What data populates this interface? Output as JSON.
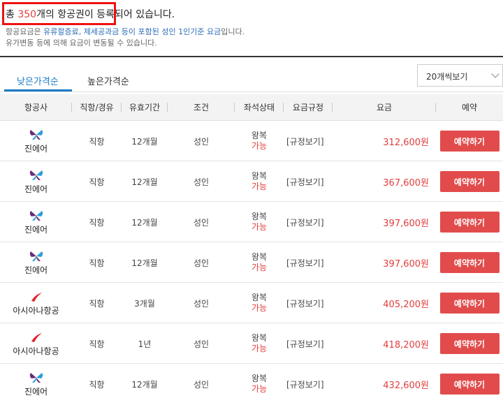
{
  "summary": {
    "prefix": "총 ",
    "count": "350",
    "suffix": "개의 항공권이 등록되어 있습니다."
  },
  "notices": {
    "line1_prefix": "항공요금은 ",
    "line1_highlight": "유류할증료, 제세공과금 등이 포함된 성인 1인기준 요금",
    "line1_suffix": "입니다.",
    "line2": "유가변동 등에 의해 요금이 변동될 수 있습니다."
  },
  "tabs": {
    "active": "낮은가격순",
    "inactive": "높은가격순"
  },
  "page_size_select": {
    "value": "20개씩보기"
  },
  "table": {
    "headers": {
      "airline": "항공사",
      "route": "직항/경유",
      "validity": "유효기간",
      "condition": "조건",
      "seat": "좌석상태",
      "rule": "요금규정",
      "fare": "요금",
      "reserve": "예약"
    },
    "rows": [
      {
        "airline": "진에어",
        "logo": "jinair",
        "route": "직항",
        "validity": "12개월",
        "condition": "성인",
        "seat_type": "왕복",
        "seat_status": "가능",
        "rule": "[규정보기]",
        "fare": "312,600원",
        "book": "예약하기"
      },
      {
        "airline": "진에어",
        "logo": "jinair",
        "route": "직항",
        "validity": "12개월",
        "condition": "성인",
        "seat_type": "왕복",
        "seat_status": "가능",
        "rule": "[규정보기]",
        "fare": "367,600원",
        "book": "예약하기"
      },
      {
        "airline": "진에어",
        "logo": "jinair",
        "route": "직항",
        "validity": "12개월",
        "condition": "성인",
        "seat_type": "왕복",
        "seat_status": "가능",
        "rule": "[규정보기]",
        "fare": "397,600원",
        "book": "예약하기"
      },
      {
        "airline": "진에어",
        "logo": "jinair",
        "route": "직항",
        "validity": "12개월",
        "condition": "성인",
        "seat_type": "왕복",
        "seat_status": "가능",
        "rule": "[규정보기]",
        "fare": "397,600원",
        "book": "예약하기"
      },
      {
        "airline": "아시아나항공",
        "logo": "asiana",
        "route": "직항",
        "validity": "3개월",
        "condition": "성인",
        "seat_type": "왕복",
        "seat_status": "가능",
        "rule": "[규정보기]",
        "fare": "405,200원",
        "book": "예약하기"
      },
      {
        "airline": "아시아나항공",
        "logo": "asiana",
        "route": "직항",
        "validity": "1년",
        "condition": "성인",
        "seat_type": "왕복",
        "seat_status": "가능",
        "rule": "[규정보기]",
        "fare": "418,200원",
        "book": "예약하기"
      },
      {
        "airline": "진에어",
        "logo": "jinair",
        "route": "직항",
        "validity": "12개월",
        "condition": "성인",
        "seat_type": "왕복",
        "seat_status": "가능",
        "rule": "[규정보기]",
        "fare": "432,600원",
        "book": "예약하기"
      }
    ]
  },
  "colors": {
    "accent_blue": "#1a7bc7",
    "price_red": "#e23d3d",
    "button_red": "#e24b4b",
    "highlight_box": "#ee1111"
  }
}
